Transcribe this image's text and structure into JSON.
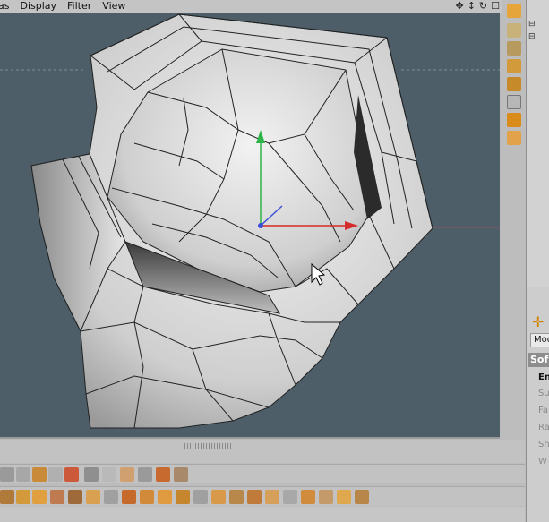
{
  "menubar": {
    "items": [
      {
        "label": "as"
      },
      {
        "label": "Display"
      },
      {
        "label": "Filter"
      },
      {
        "label": "View"
      }
    ],
    "nav_icons": [
      {
        "name": "move-view-icon",
        "glyph": "✥"
      },
      {
        "name": "zoom-view-icon",
        "glyph": "↕"
      },
      {
        "name": "rotate-view-icon",
        "glyph": "↻"
      },
      {
        "name": "maximize-view-icon",
        "glyph": "☐"
      }
    ]
  },
  "attributes": {
    "mode_label": "Mod",
    "tab_label": "Sof",
    "items": [
      "En",
      "Su",
      "Fa",
      "Ra",
      "Sh",
      "W"
    ]
  },
  "colors": {
    "viewport_bg": "#4d5e68",
    "mesh_fill": "#d9d9d9",
    "axis_y": "#2db54a",
    "axis_x": "#d52b2b",
    "accent": "#e59b1c"
  }
}
